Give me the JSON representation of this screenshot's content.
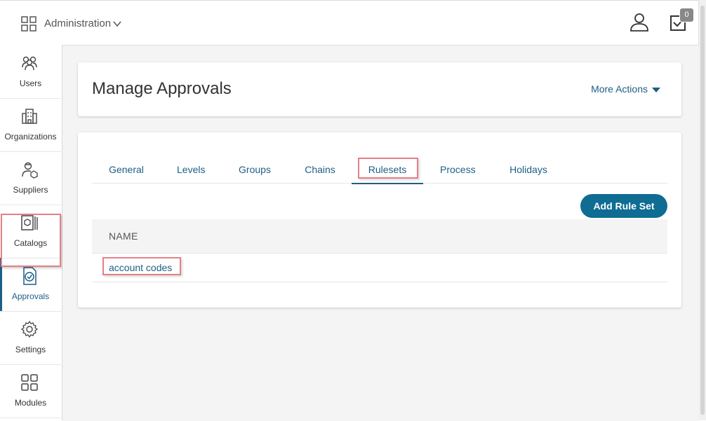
{
  "topbar": {
    "app_label": "Administration",
    "task_count": "0"
  },
  "sidebar": {
    "items": [
      {
        "label": "Users",
        "icon": "users-icon"
      },
      {
        "label": "Organizations",
        "icon": "building-icon"
      },
      {
        "label": "Suppliers",
        "icon": "supplier-icon"
      },
      {
        "label": "Catalogs",
        "icon": "catalog-icon"
      },
      {
        "label": "Approvals",
        "icon": "approval-icon",
        "active": true
      },
      {
        "label": "Settings",
        "icon": "gear-icon"
      },
      {
        "label": "Modules",
        "icon": "modules-icon"
      }
    ]
  },
  "header": {
    "title": "Manage Approvals",
    "more_actions": "More Actions"
  },
  "tabs": [
    {
      "label": "General"
    },
    {
      "label": "Levels"
    },
    {
      "label": "Groups"
    },
    {
      "label": "Chains"
    },
    {
      "label": "Rulesets",
      "active": true
    },
    {
      "label": "Process"
    },
    {
      "label": "Holidays"
    }
  ],
  "actions": {
    "add_label": "Add Rule Set"
  },
  "table": {
    "columns": [
      "NAME"
    ],
    "rows": [
      {
        "name": "account codes"
      }
    ]
  },
  "colors": {
    "accent": "#1d5f84",
    "button": "#0f6c93",
    "highlight": "#e57f86"
  }
}
